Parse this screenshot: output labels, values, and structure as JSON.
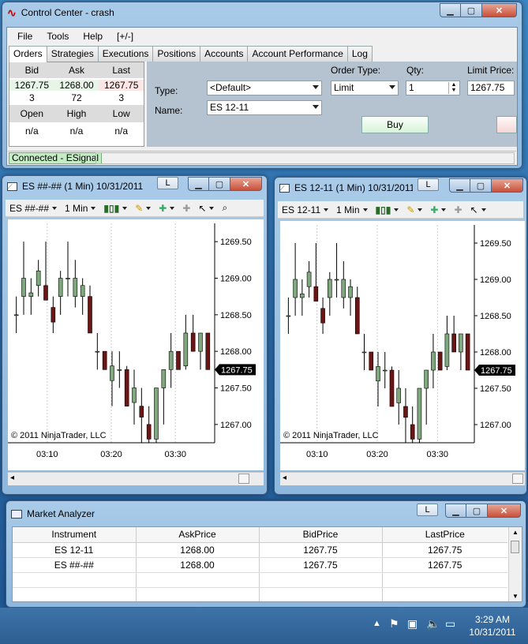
{
  "control_center": {
    "title": "Control Center - crash",
    "menu": [
      "File",
      "Tools",
      "Help",
      "[+/-]"
    ],
    "tabs": [
      "Orders",
      "Strategies",
      "Executions",
      "Positions",
      "Accounts",
      "Account Performance",
      "Log"
    ],
    "quote": {
      "bid_label": "Bid",
      "ask_label": "Ask",
      "last_label": "Last",
      "bid": "1267.75",
      "ask": "1268.00",
      "last": "1267.75",
      "bid_size": "3",
      "ask_size": "72",
      "last_size": "3",
      "open_label": "Open",
      "high_label": "High",
      "low_label": "Low",
      "open": "n/a",
      "high": "n/a",
      "low": "n/a"
    },
    "type_label": "Type:",
    "type_value": "<Default>",
    "name_label": "Name:",
    "name_value": "ES 12-11",
    "order_type_label": "Order Type:",
    "order_type_value": "Limit",
    "qty_label": "Qty:",
    "qty_value": "1",
    "limit_price_label": "Limit Price:",
    "limit_price_value": "1267.75",
    "buy_label": "Buy",
    "status": "Connected - ESignal"
  },
  "chart1": {
    "title": "ES ##-## (1 Min)  10/31/2011",
    "instrument": "ES ##-##",
    "interval": "1 Min",
    "copyright": "© 2011 NinjaTrader, LLC",
    "x_ticks": [
      "03:10",
      "03:20",
      "03:30"
    ],
    "y_ticks": [
      "1269.50",
      "1269.00",
      "1268.50",
      "1268.00",
      "1267.50",
      "1267.00"
    ],
    "last_price": "1267.75"
  },
  "chart2": {
    "title": "ES 12-11 (1 Min)  10/31/2011",
    "instrument": "ES 12-11",
    "interval": "1 Min",
    "copyright": "© 2011 NinjaTrader, LLC",
    "x_ticks": [
      "03:10",
      "03:20",
      "03:30"
    ],
    "y_ticks": [
      "1269.50",
      "1269.00",
      "1268.50",
      "1268.00",
      "1267.50",
      "1267.00"
    ],
    "last_price": "1267.75"
  },
  "market_analyzer": {
    "title": "Market Analyzer",
    "columns": [
      "Instrument",
      "AskPrice",
      "BidPrice",
      "LastPrice"
    ],
    "rows": [
      [
        "ES 12-11",
        "1268.00",
        "1267.75",
        "1267.75"
      ],
      [
        "ES ##-##",
        "1268.00",
        "1267.75",
        "1267.75"
      ]
    ]
  },
  "taskbar": {
    "time": "3:29 AM",
    "date": "10/31/2011"
  },
  "colors": {
    "bull": "#3f6f3f",
    "bear": "#6b1515",
    "accent": "#3a5a80"
  }
}
